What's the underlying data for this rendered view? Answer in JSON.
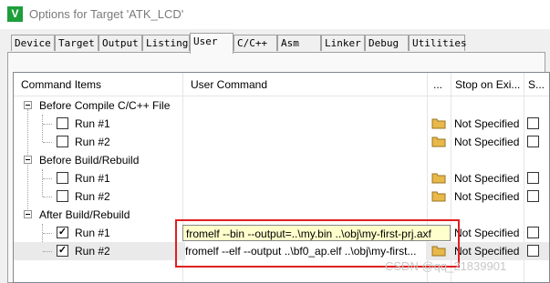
{
  "window": {
    "title": "Options for Target 'ATK_LCD'",
    "icon": "keil-v-icon"
  },
  "tabs": [
    {
      "label": "Device"
    },
    {
      "label": "Target"
    },
    {
      "label": "Output"
    },
    {
      "label": "Listing"
    },
    {
      "label": "User",
      "active": true
    },
    {
      "label": "C/C++"
    },
    {
      "label": "Asm"
    },
    {
      "label": "Linker"
    },
    {
      "label": "Debug"
    },
    {
      "label": "Utilities"
    }
  ],
  "columns": {
    "items": "Command Items",
    "command": "User Command",
    "browse": "...",
    "stop": "Stop on Exi...",
    "s": "S..."
  },
  "groups": [
    {
      "label": "Before Compile C/C++ File",
      "runs": [
        {
          "label": "Run #1",
          "checked": false,
          "command": "",
          "stop": "Not Specified"
        },
        {
          "label": "Run #2",
          "checked": false,
          "command": "",
          "stop": "Not Specified"
        }
      ]
    },
    {
      "label": "Before Build/Rebuild",
      "runs": [
        {
          "label": "Run #1",
          "checked": false,
          "command": "",
          "stop": "Not Specified"
        },
        {
          "label": "Run #2",
          "checked": false,
          "command": "",
          "stop": "Not Specified"
        }
      ]
    },
    {
      "label": "After Build/Rebuild",
      "runs": [
        {
          "label": "Run #1",
          "checked": true,
          "command": "fromelf --bin --output=..\\my.bin ..\\obj\\my-first-prj.axf",
          "stop": "Not Specified"
        },
        {
          "label": "Run #2",
          "checked": true,
          "command": "fromelf --elf --output ..\\bf0_ap.elf ..\\obj\\my-first...",
          "stop": "Not Specified"
        }
      ]
    }
  ],
  "watermark": "CSDN @qq_21839901",
  "colors": {
    "highlight": "#e02020",
    "folder": "#e8b84a"
  }
}
